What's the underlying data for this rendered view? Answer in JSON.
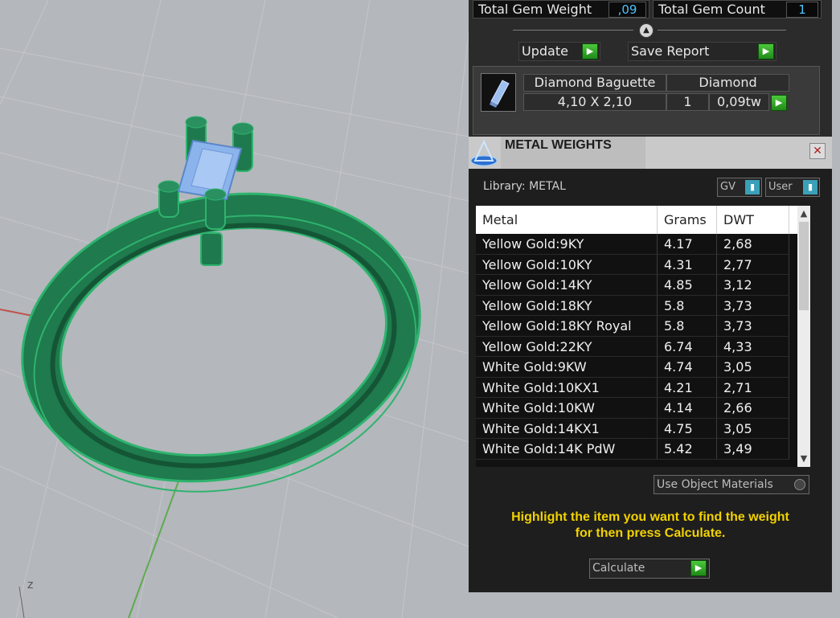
{
  "gem_summary": {
    "total_weight_label": "Total Gem Weight",
    "total_weight_value": ",09",
    "total_count_label": "Total Gem Count",
    "total_count_value": "1"
  },
  "buttons": {
    "update": "Update",
    "save_report": "Save Report"
  },
  "gem_item": {
    "name": "Diamond Baguette",
    "material": "Diamond",
    "size": "4,10 X 2,10",
    "count": "1",
    "weight": "0,09tw"
  },
  "metal_weights": {
    "title": "METAL WEIGHTS",
    "library": "Library: METAL",
    "gv_label": "GV",
    "user_label": "User",
    "columns": [
      "Metal",
      "Grams",
      "DWT"
    ],
    "rows": [
      {
        "metal": "Yellow Gold:9KY",
        "grams": "4.17",
        "dwt": "2,68"
      },
      {
        "metal": "Yellow Gold:10KY",
        "grams": "4.31",
        "dwt": "2,77"
      },
      {
        "metal": "Yellow Gold:14KY",
        "grams": "4.85",
        "dwt": "3,12"
      },
      {
        "metal": "Yellow Gold:18KY",
        "grams": "5.8",
        "dwt": "3,73"
      },
      {
        "metal": "Yellow Gold:18KY Royal",
        "grams": "5.8",
        "dwt": "3,73"
      },
      {
        "metal": "Yellow Gold:22KY",
        "grams": "6.74",
        "dwt": "4,33"
      },
      {
        "metal": "White Gold:9KW",
        "grams": "4.74",
        "dwt": "3,05"
      },
      {
        "metal": "White Gold:10KX1",
        "grams": "4.21",
        "dwt": "2,71"
      },
      {
        "metal": "White Gold:10KW",
        "grams": "4.14",
        "dwt": "2,66"
      },
      {
        "metal": "White Gold:14KX1",
        "grams": "4.75",
        "dwt": "3,05"
      },
      {
        "metal": "White Gold:14K PdW",
        "grams": "5.42",
        "dwt": "3,49"
      }
    ],
    "use_object_materials": "Use Object Materials",
    "hint_line1": "Highlight the item you want to find the weight",
    "hint_line2": "for then press Calculate.",
    "calculate": "Calculate"
  },
  "viewport": {
    "axis_label_z": "z"
  },
  "colors": {
    "ring": "#1e7a4e",
    "gem": "#8cb4ec",
    "hint": "#f2d200",
    "accent_go": "#3cb830"
  }
}
